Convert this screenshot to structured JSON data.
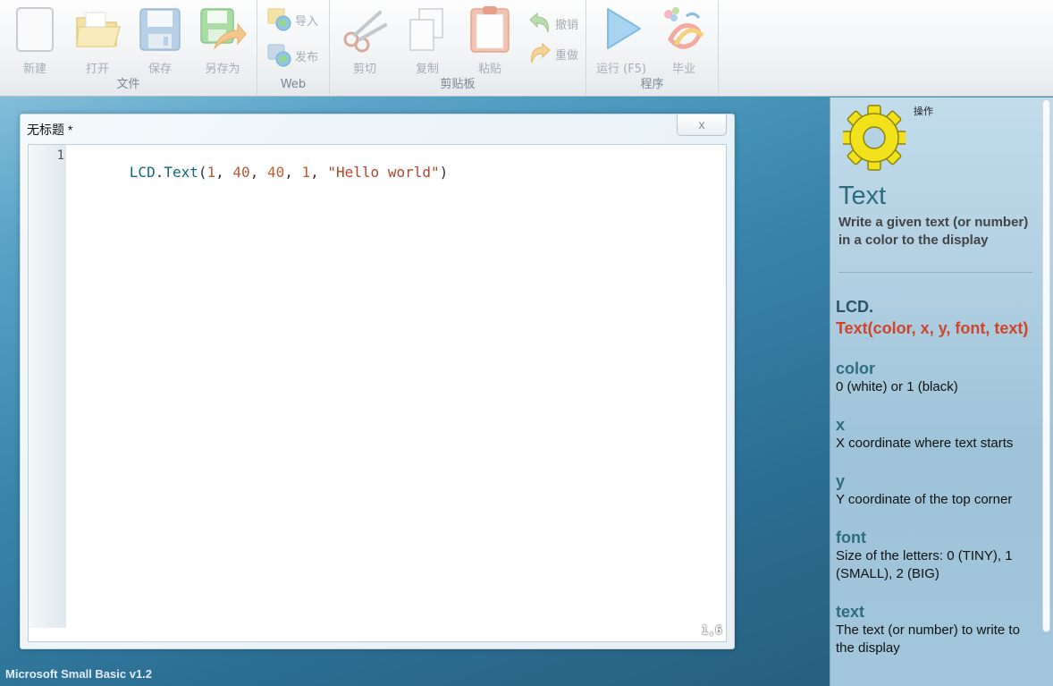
{
  "ribbon": {
    "groups": [
      {
        "label": "文件",
        "buttons": [
          {
            "label": "新建"
          },
          {
            "label": "打开"
          },
          {
            "label": "保存"
          },
          {
            "label": "另存为"
          }
        ]
      },
      {
        "label": "Web",
        "buttons": [
          {
            "label": "导入"
          },
          {
            "label": "发布"
          }
        ]
      },
      {
        "label": "剪贴板",
        "buttons": [
          {
            "label": "剪切"
          },
          {
            "label": "复制"
          },
          {
            "label": "粘贴"
          },
          {
            "label": "撤销"
          },
          {
            "label": "重做"
          }
        ]
      },
      {
        "label": "程序",
        "buttons": [
          {
            "label": "运行 (F5)"
          },
          {
            "label": "毕业"
          }
        ]
      }
    ]
  },
  "editor": {
    "title": "无标题 *",
    "close_label": "x",
    "lines": [
      {
        "number": "1",
        "tokens": [
          {
            "text": "LCD",
            "kind": "obj"
          },
          {
            "text": ".",
            "kind": "op"
          },
          {
            "text": "Text",
            "kind": "obj"
          },
          {
            "text": "(",
            "kind": "op"
          },
          {
            "text": "1",
            "kind": "num"
          },
          {
            "text": ", ",
            "kind": "op"
          },
          {
            "text": "40",
            "kind": "num"
          },
          {
            "text": ", ",
            "kind": "op"
          },
          {
            "text": "40",
            "kind": "num"
          },
          {
            "text": ", ",
            "kind": "op"
          },
          {
            "text": "1",
            "kind": "num"
          },
          {
            "text": ", ",
            "kind": "op"
          },
          {
            "text": "\"Hello world\"",
            "kind": "str"
          },
          {
            "text": ")",
            "kind": "op"
          }
        ]
      }
    ],
    "cursor_position": "1,6"
  },
  "app": {
    "version": "Microsoft Small Basic v1.2"
  },
  "help": {
    "section_label": "操作",
    "icon": "gear-icon",
    "title": "Text",
    "summary": "Write a given text (or number) in a color to the display",
    "object": "LCD.",
    "signature": "Text(color, x, y, font, text)",
    "params": [
      {
        "name": "color",
        "description": "0 (white) or 1 (black)"
      },
      {
        "name": "x",
        "description": "X coordinate where text starts"
      },
      {
        "name": "y",
        "description": "Y coordinate of the top corner"
      },
      {
        "name": "font",
        "description": "Size of the letters: 0 (TINY), 1 (SMALL), 2 (BIG)"
      },
      {
        "name": "text",
        "description": "The text (or number) to write to the display"
      }
    ]
  },
  "colors": {
    "accent": "#2e6d7f",
    "signature": "#d0452a",
    "string_literal": "#b4452b",
    "number_literal": "#c05b35"
  }
}
